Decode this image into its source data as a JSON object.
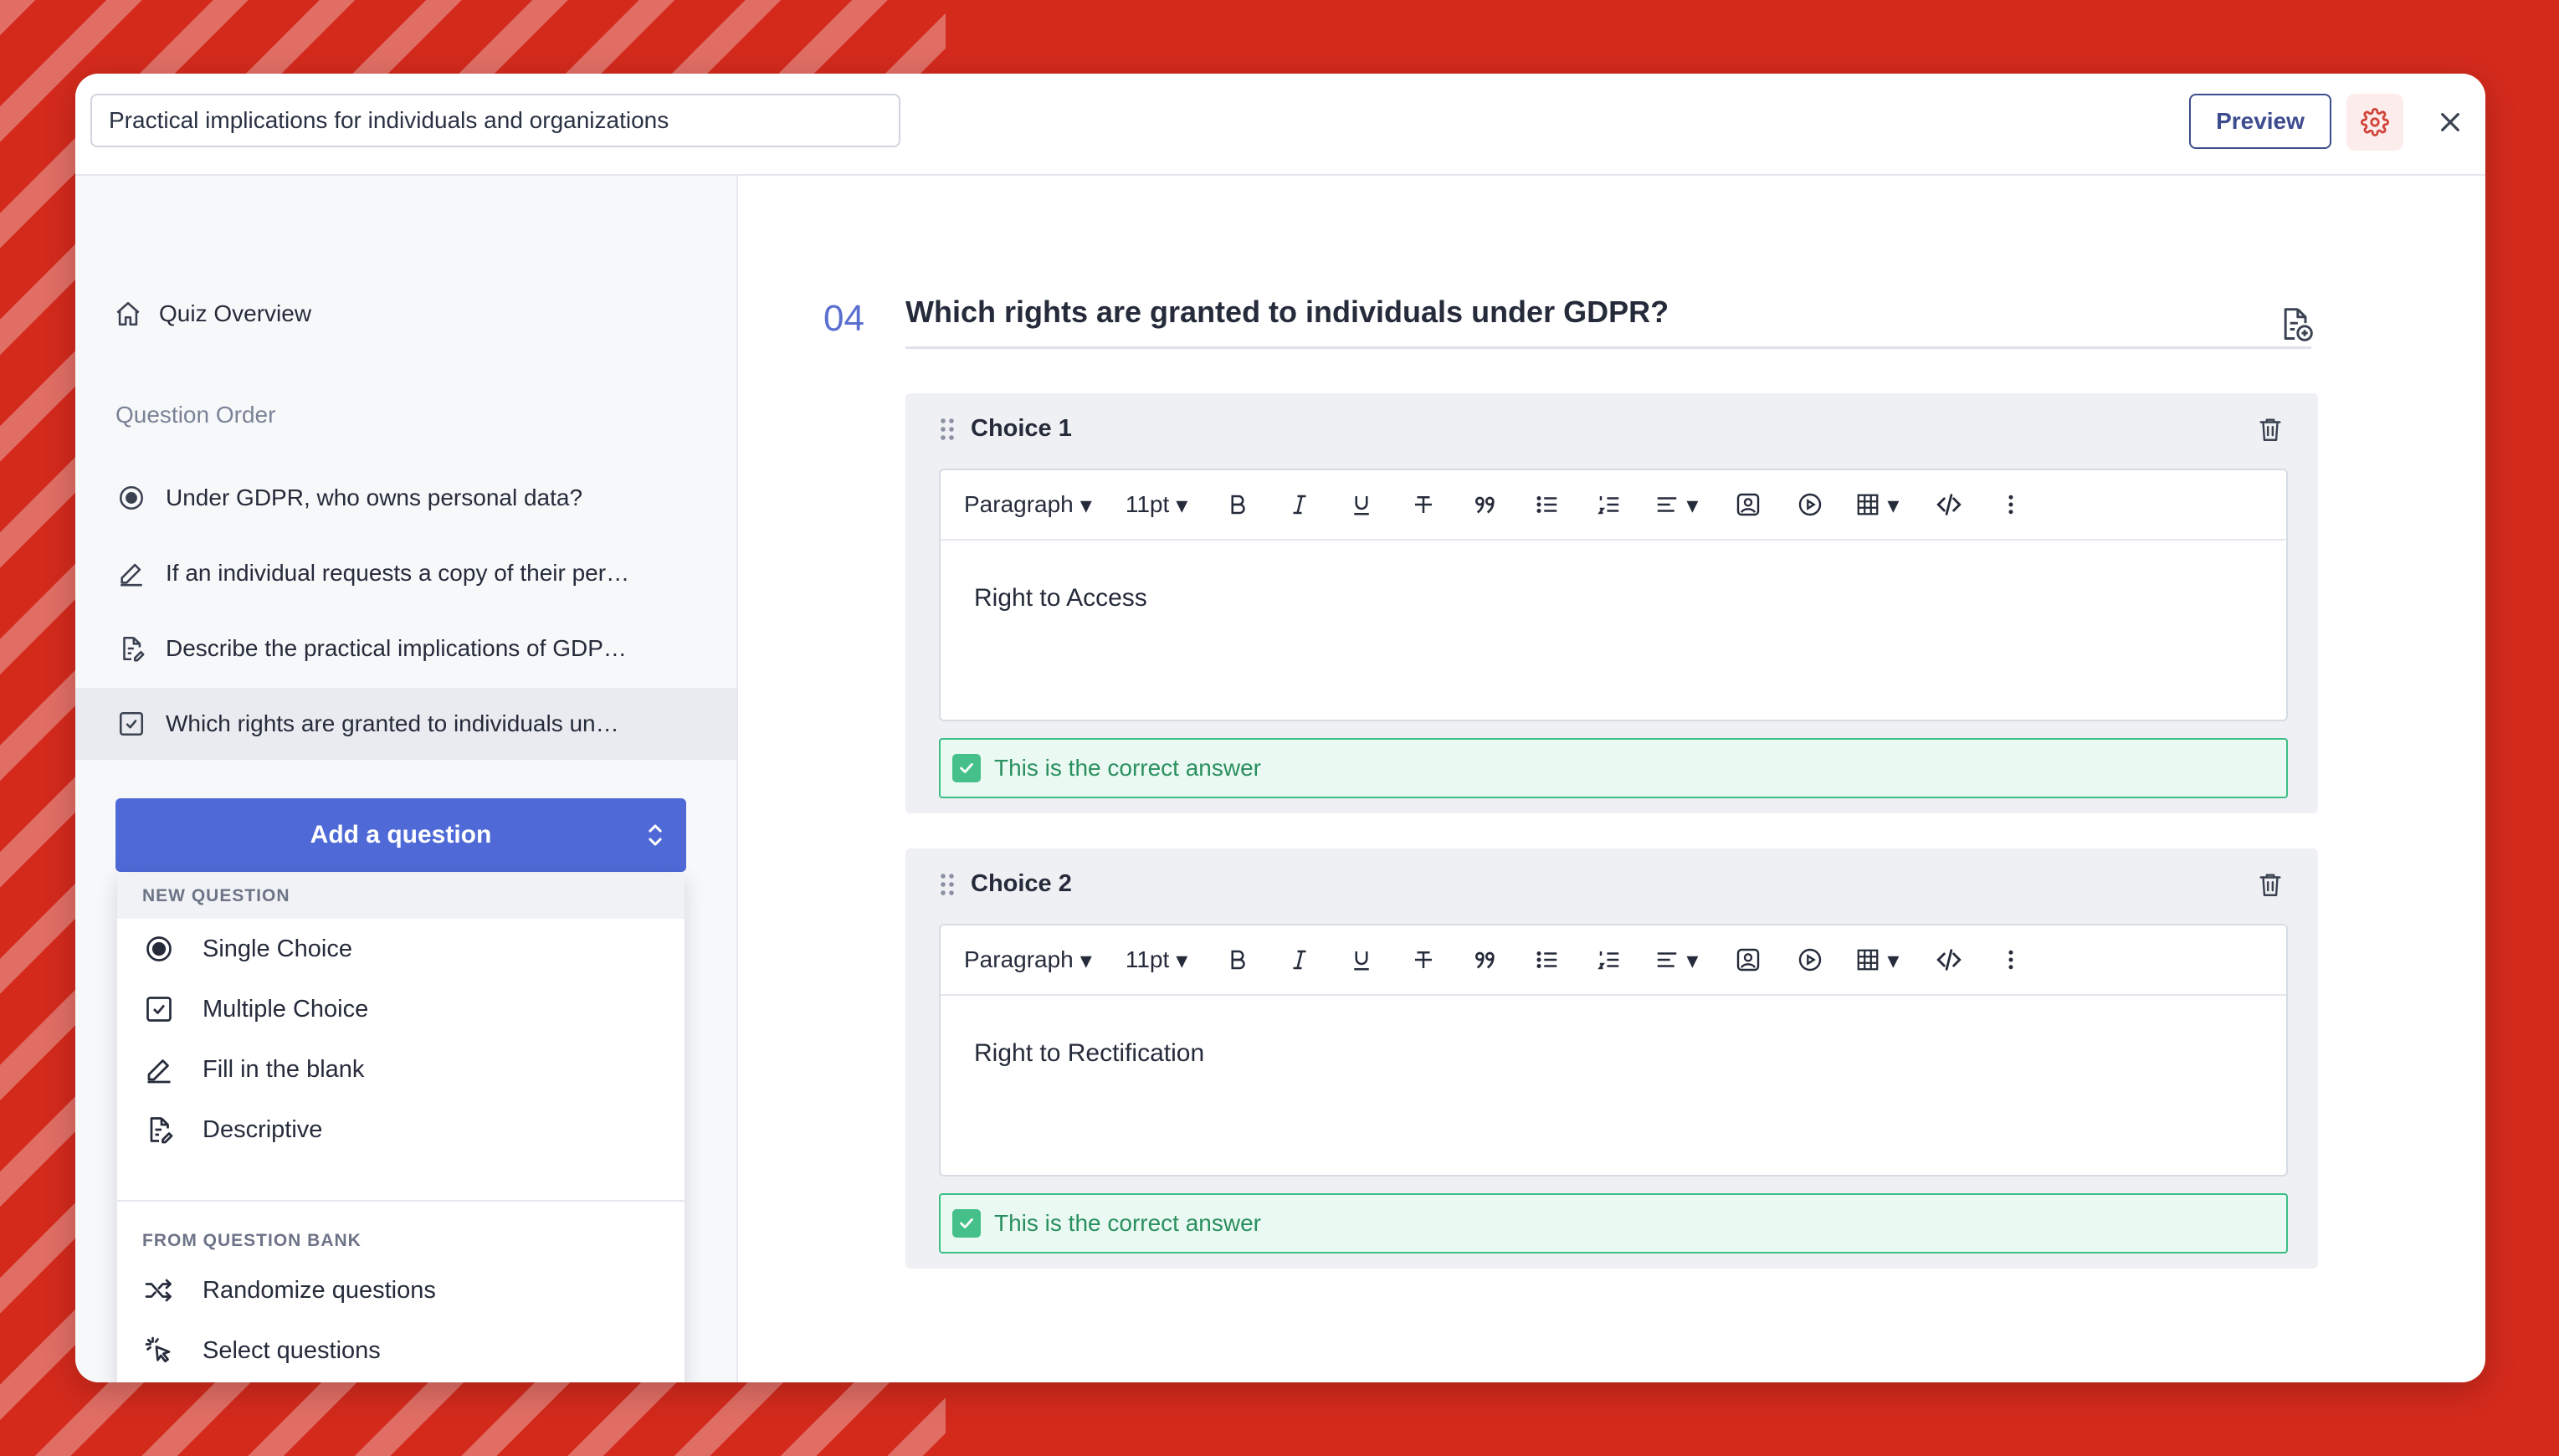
{
  "header": {
    "quiz_title": "Practical implications for individuals and organizations",
    "preview_label": "Preview"
  },
  "sidebar": {
    "overview_label": "Quiz Overview",
    "order_heading": "Question Order",
    "questions": [
      {
        "label": "Under GDPR, who owns personal data?",
        "icon": "single-choice-icon"
      },
      {
        "label": "If an individual requests a copy of their per…",
        "icon": "pencil-icon"
      },
      {
        "label": "Describe the practical implications of GDP…",
        "icon": "descriptive-icon"
      },
      {
        "label": "Which rights are granted to individuals un…",
        "icon": "multiple-choice-icon"
      }
    ],
    "add_question_label": "Add a question"
  },
  "menu": {
    "new_heading": "NEW QUESTION",
    "items": [
      "Single Choice",
      "Multiple Choice",
      "Fill in the blank",
      "Descriptive"
    ],
    "bank_heading": "FROM QUESTION BANK",
    "bank_items": [
      "Randomize questions",
      "Select questions"
    ]
  },
  "question": {
    "number": "04",
    "title": "Which rights are granted to individuals under GDPR?"
  },
  "choices": [
    {
      "title": "Choice 1",
      "text": "Right to Access",
      "correct_label": "This is the correct answer",
      "correct": true
    },
    {
      "title": "Choice 2",
      "text": "Right to Rectification",
      "correct_label": "This is the correct answer",
      "correct": true
    }
  ],
  "toolbar": {
    "paragraph": "Paragraph",
    "font_size": "11pt"
  },
  "colors": {
    "brand_red": "#d32a1c",
    "accent_blue": "#4f6ad6",
    "success_green": "#46c08b"
  }
}
